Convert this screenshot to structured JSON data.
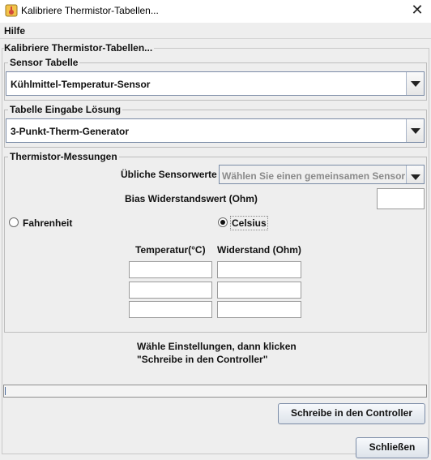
{
  "window": {
    "title": "Kalibriere Thermistor-Tabellen...",
    "close_glyph": "✕"
  },
  "menu": {
    "items": [
      "Hilfe"
    ]
  },
  "panel": {
    "title": "Kalibriere Thermistor-Tabellen..."
  },
  "sensor_table": {
    "legend": "Sensor Tabelle",
    "selected": "Kühlmittel-Temperatur-Sensor"
  },
  "input_solution": {
    "legend": "Tabelle Eingabe Lösung",
    "selected": "3-Punkt-Therm-Generator"
  },
  "measurements": {
    "legend": "Thermistor-Messungen",
    "common_sensors_label": "Übliche Sensorwerte",
    "common_sensors_value": "Wählen Sie einen gemeinsamen Sensor",
    "bias_label": "Bias Widerstandswert (Ohm)",
    "bias_value": "",
    "units": {
      "fahrenheit": "Fahrenheit",
      "celsius": "Celsius",
      "selected": "Celsius"
    },
    "col_temp": "Temperatur(°C)",
    "col_res": "Widerstand (Ohm)",
    "rows": [
      {
        "temp": "",
        "res": ""
      },
      {
        "temp": "",
        "res": ""
      },
      {
        "temp": "",
        "res": ""
      }
    ]
  },
  "instructions": {
    "line1": "Wähle Einstellungen, dann klicken",
    "line2": "\"Schreibe in den Controller\""
  },
  "progress": {
    "value": 0
  },
  "buttons": {
    "write": "Schreibe in den Controller",
    "close": "Schließen"
  },
  "colors": {
    "accent_border": "#7a8ba6",
    "background": "#eeeeee"
  },
  "icons": {
    "app": "thermometer-app-icon",
    "dropdown": "chevron-down-icon"
  }
}
